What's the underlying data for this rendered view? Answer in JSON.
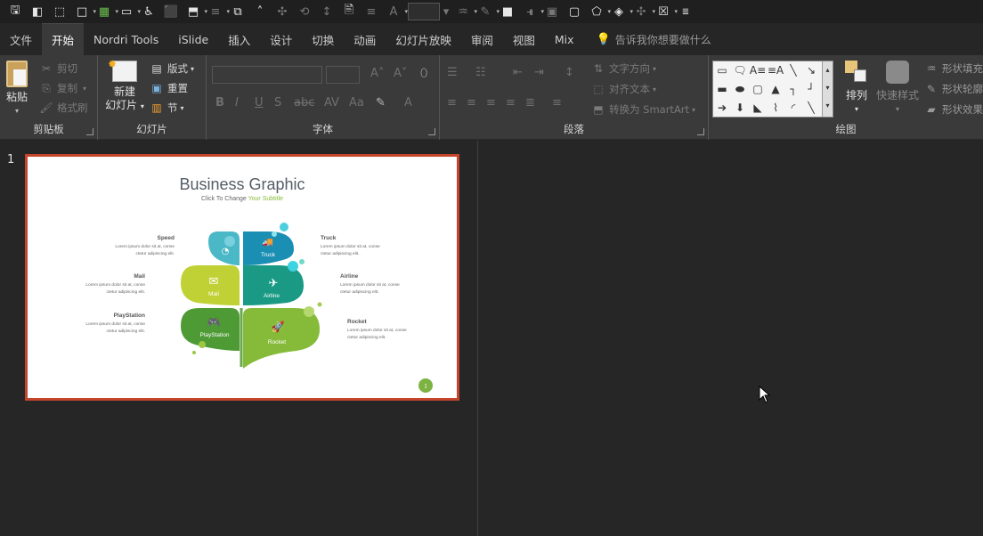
{
  "tabs": [
    "文件",
    "开始",
    "Nordri Tools",
    "iSlide",
    "插入",
    "设计",
    "切换",
    "动画",
    "幻灯片放映",
    "审阅",
    "视图",
    "Mix"
  ],
  "active_tab": "开始",
  "tell_me": "告诉我你想要做什么",
  "clipboard": {
    "label": "剪贴板",
    "paste": "粘贴",
    "cut": "剪切",
    "copy": "复制",
    "format_painter": "格式刷"
  },
  "slides": {
    "label": "幻灯片",
    "new_slide_1": "新建",
    "new_slide_2": "幻灯片",
    "layout": "版式",
    "reset": "重置",
    "section": "节"
  },
  "font": {
    "label": "字体"
  },
  "paragraph": {
    "label": "段落",
    "text_direction": "文字方向",
    "align_text": "对齐文本",
    "convert_smartart": "转换为 SmartArt"
  },
  "drawing": {
    "label": "绘图",
    "arrange": "排列",
    "quick_styles": "快速样式",
    "shape_fill": "形状填充",
    "shape_outline": "形状轮廓",
    "shape_effects": "形状效果"
  },
  "slide_number": "1",
  "slide": {
    "title": "Business Graphic",
    "subtitle_a": "Click To Change ",
    "subtitle_b": "Your Subtitle",
    "page_badge": "1",
    "lorem_1": "Lorem ipsum dolor sit at, conse",
    "lorem_2": "ctetur adipiscing elit.",
    "items_left": [
      {
        "title": "Speed"
      },
      {
        "title": "Mail"
      },
      {
        "title": "PlayStation"
      }
    ],
    "items_right": [
      {
        "title": "Truck"
      },
      {
        "title": "Airline"
      },
      {
        "title": "Rocket"
      }
    ],
    "leaves": [
      "Speed",
      "Truck",
      "Mail",
      "Airline",
      "PlayStation",
      "Rocket"
    ],
    "colors": {
      "teal_light": "#4bb8c7",
      "blue": "#1b8fb3",
      "lime": "#c0d135",
      "teal": "#1a9a84",
      "green": "#4e9a35",
      "light_green": "#86bb3a",
      "accent_cyan": "#3ed3e0",
      "badge": "#7cb342"
    }
  }
}
